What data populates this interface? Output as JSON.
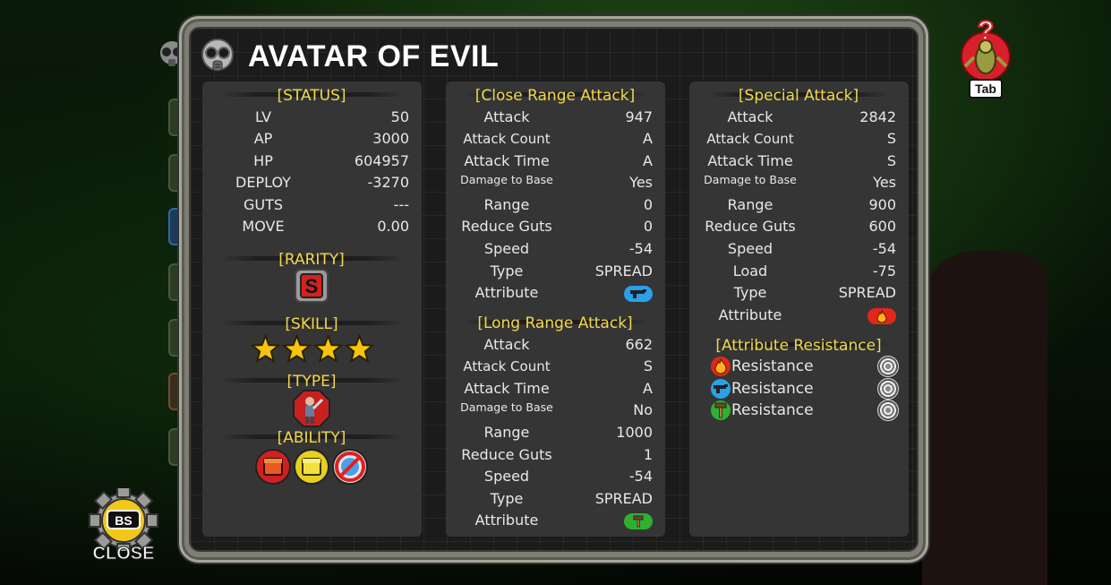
{
  "title": "AVATAR OF EVIL",
  "status": {
    "heading": "[STATUS]",
    "rows": [
      {
        "label": "LV",
        "value": "50"
      },
      {
        "label": "AP",
        "value": "3000"
      },
      {
        "label": "HP",
        "value": "604957"
      },
      {
        "label": "DEPLOY",
        "value": "-3270"
      },
      {
        "label": "GUTS",
        "value": "---"
      },
      {
        "label": "MOVE",
        "value": "0.00"
      }
    ],
    "rarity_heading": "[RARITY]",
    "rarity_letter": "S",
    "skill_heading": "[SKILL]",
    "skill_stars": 4,
    "type_heading": "[TYPE]",
    "ability_heading": "[ABILITY]"
  },
  "close_range": {
    "heading": "[Close Range Attack]",
    "attack_label": "Attack",
    "attack": "947",
    "count_label": "Attack Count",
    "count": "A",
    "time_label": "Attack Time",
    "time": "A",
    "dmg_label": "Damage to Base",
    "dmg": "Yes",
    "range_label": "Range",
    "range": "0",
    "guts_label": "Reduce Guts",
    "guts": "0",
    "speed_label": "Speed",
    "speed": "-54",
    "type_label": "Type",
    "type": "SPREAD",
    "attr_label": "Attribute",
    "attr_icon": "gun-icon"
  },
  "long_range": {
    "heading": "[Long Range Attack]",
    "attack_label": "Attack",
    "attack": "662",
    "count_label": "Attack Count",
    "count": "S",
    "time_label": "Attack Time",
    "time": "A",
    "dmg_label": "Damage to Base",
    "dmg": "No",
    "range_label": "Range",
    "range": "1000",
    "guts_label": "Reduce Guts",
    "guts": "1",
    "speed_label": "Speed",
    "speed": "-54",
    "type_label": "Type",
    "type": "SPREAD",
    "attr_label": "Attribute",
    "attr_icon": "hammer-icon"
  },
  "special": {
    "heading": "[Special Attack]",
    "attack_label": "Attack",
    "attack": "2842",
    "count_label": "Attack Count",
    "count": "S",
    "time_label": "Attack Time",
    "time": "S",
    "dmg_label": "Damage to Base",
    "dmg": "Yes",
    "range_label": "Range",
    "range": "900",
    "guts_label": "Reduce Guts",
    "guts": "600",
    "speed_label": "Speed",
    "speed": "-54",
    "load_label": "Load",
    "load": "-75",
    "type_label": "Type",
    "type": "SPREAD",
    "attr_label": "Attribute",
    "attr_icon": "fire-icon"
  },
  "resistance": {
    "heading": "[Attribute Resistance]",
    "items": [
      {
        "icon": "fire-icon",
        "label": "Resistance"
      },
      {
        "icon": "gun-icon",
        "label": "Resistance"
      },
      {
        "icon": "hammer-icon",
        "label": "Resistance"
      }
    ]
  },
  "buttons": {
    "tab_label": "Tab",
    "tab_badge": "?",
    "close_key": "BS",
    "close_label": "CLOSE"
  },
  "colors": {
    "heading": "#f2d84a",
    "grade_red": "#e02020",
    "grade_purple": "#c030e0",
    "panel": "#353535"
  }
}
